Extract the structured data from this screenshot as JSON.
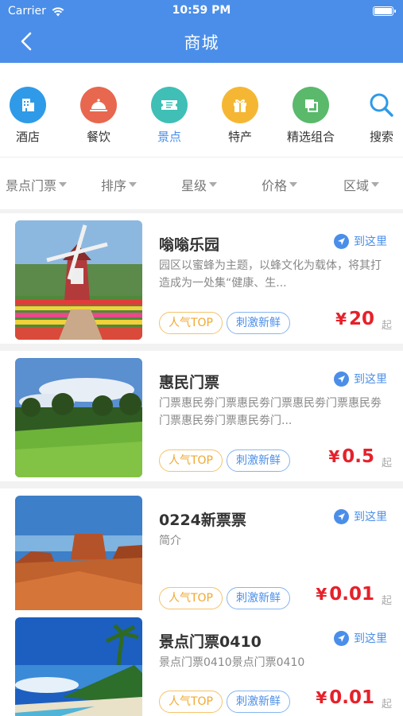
{
  "status": {
    "carrier": "Carrier",
    "time": "10:59 PM"
  },
  "nav": {
    "title": "商城"
  },
  "categories": [
    {
      "label": "酒店",
      "icon": "hotel-icon",
      "color": "#2f9ae8"
    },
    {
      "label": "餐饮",
      "icon": "dining-icon",
      "color": "#e8674f"
    },
    {
      "label": "景点",
      "icon": "ticket-icon",
      "color": "#3fbfb6"
    },
    {
      "label": "特产",
      "icon": "gift-icon",
      "color": "#f5b733"
    },
    {
      "label": "精选组合",
      "icon": "combo-icon",
      "color": "#5ab96b"
    },
    {
      "label": "搜索",
      "icon": "search-icon",
      "color": "#2f9ae8"
    }
  ],
  "filters": [
    "景点门票",
    "排序",
    "星级",
    "价格",
    "区域"
  ],
  "items": [
    {
      "name": "嗡嗡乐园",
      "goto": "到这里",
      "desc": "园区以蜜蜂为主题，以蜂文化为载体，将其打造成为一处集“健康、生...",
      "tag1": "人气TOP",
      "tag2": "刺激新鲜",
      "yen": "¥",
      "price": "20",
      "unit": "起"
    },
    {
      "name": "惠民门票",
      "goto": "到这里",
      "desc": "门票惠民劵门票惠民劵门票惠民劵门票惠民劵门票惠民劵门票惠民劵门...",
      "tag1": "人气TOP",
      "tag2": "刺激新鲜",
      "yen": "¥",
      "price": "0.5",
      "unit": "起"
    },
    {
      "name": "0224新票票",
      "goto": "到这里",
      "desc": "简介",
      "tag1": "人气TOP",
      "tag2": "刺激新鲜",
      "yen": "¥",
      "price": "0.01",
      "unit": "起"
    },
    {
      "name": "景点门票0410",
      "goto": "到这里",
      "desc": "景点门票0410景点门票0410",
      "tag1": "人气TOP",
      "tag2": "刺激新鲜",
      "yen": "¥",
      "price": "0.01",
      "unit": "起"
    }
  ]
}
